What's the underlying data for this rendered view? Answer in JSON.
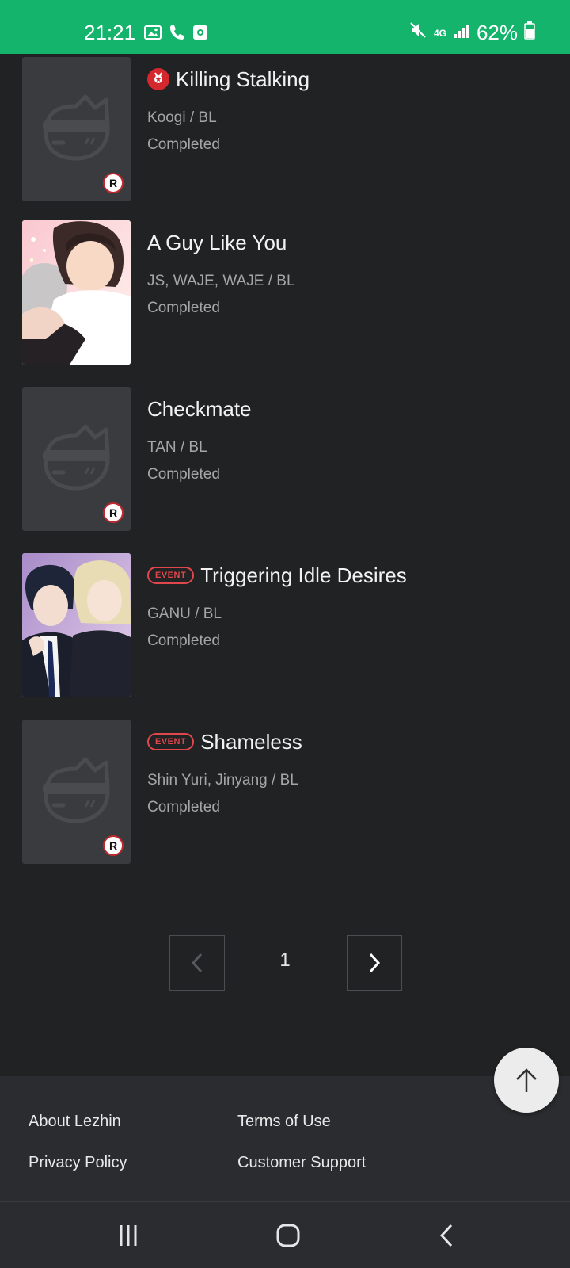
{
  "status_bar": {
    "time": "21:21",
    "network": "4G",
    "battery": "62%"
  },
  "comics": [
    {
      "title": "Killing Stalking",
      "authors": "Koogi / BL",
      "status": "Completed",
      "badge": "award",
      "rating": "R",
      "thumb": "placeholder"
    },
    {
      "title": "A Guy Like You",
      "authors": "JS, WAJE, WAJE / BL",
      "status": "Completed",
      "badge": "",
      "rating": "",
      "thumb": "image"
    },
    {
      "title": "Checkmate",
      "authors": "TAN / BL",
      "status": "Completed",
      "badge": "",
      "rating": "R",
      "thumb": "placeholder"
    },
    {
      "title": "Triggering Idle Desires",
      "authors": "GANU / BL",
      "status": "Completed",
      "badge": "EVENT",
      "rating": "",
      "thumb": "image"
    },
    {
      "title": "Shameless",
      "authors": "Shin Yuri, Jinyang / BL",
      "status": "Completed",
      "badge": "EVENT",
      "rating": "R",
      "thumb": "placeholder"
    }
  ],
  "pagination": {
    "current_page": "1"
  },
  "footer": {
    "about": "About Lezhin",
    "terms": "Terms of Use",
    "privacy": "Privacy Policy",
    "support": "Customer Support"
  },
  "colors": {
    "status_bar": "#14b46c",
    "background": "#212224",
    "event": "#e0474c",
    "award": "#d5282e"
  },
  "icons": [
    "image-icon",
    "phone-icon",
    "screen-record-icon",
    "mute-icon",
    "signal-icon",
    "battery-icon",
    "chevron-left-icon",
    "chevron-right-icon",
    "arrow-up-icon",
    "recents-icon",
    "home-icon",
    "back-icon"
  ]
}
